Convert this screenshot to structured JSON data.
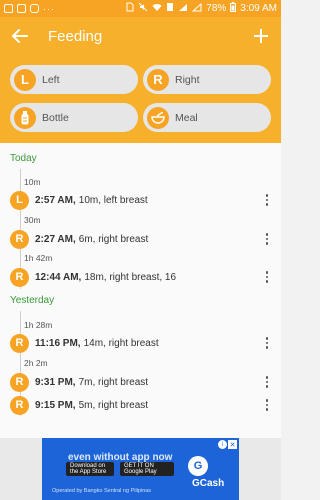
{
  "status_bar": {
    "dots": "···",
    "battery": "78%",
    "time": "3:09 AM"
  },
  "app_bar": {
    "title": "Feeding"
  },
  "actions": {
    "left": {
      "badge": "L",
      "label": "Left"
    },
    "right": {
      "badge": "R",
      "label": "Right"
    },
    "bottle": {
      "label": "Bottle"
    },
    "meal": {
      "label": "Meal"
    }
  },
  "sections": [
    {
      "title": "Today",
      "entries": [
        {
          "gap": "10m",
          "badge": "L",
          "time": "2:57 AM,",
          "desc": "10m, left breast"
        },
        {
          "gap": "30m",
          "badge": "R",
          "time": "2:27 AM,",
          "desc": "6m, right breast"
        },
        {
          "gap": "1h 42m",
          "badge": "R",
          "time": "12:44 AM,",
          "desc": "18m, right breast, 16"
        }
      ]
    },
    {
      "title": "Yesterday",
      "entries": [
        {
          "gap": "1h 28m",
          "badge": "R",
          "time": "11:16 PM,",
          "desc": "14m, right breast"
        },
        {
          "gap": "2h 2m",
          "badge": "R",
          "time": "9:31 PM,",
          "desc": "7m, right breast"
        },
        {
          "gap": "",
          "badge": "R",
          "time": "9:15 PM,",
          "desc": "5m, right breast"
        }
      ]
    }
  ],
  "ad": {
    "headline": "even without app now",
    "store1": "Download on the App Store",
    "store2": "GET IT ON Google Play",
    "brand": "GCash",
    "brand_icon": "G",
    "footer": "Operated by Bangko Sentral ng Pilipinas"
  },
  "colors": {
    "accent": "#f7a425",
    "app_bar": "#f7b02b",
    "section_title": "#3a9a3a",
    "ad_bg": "#1d64d8"
  }
}
